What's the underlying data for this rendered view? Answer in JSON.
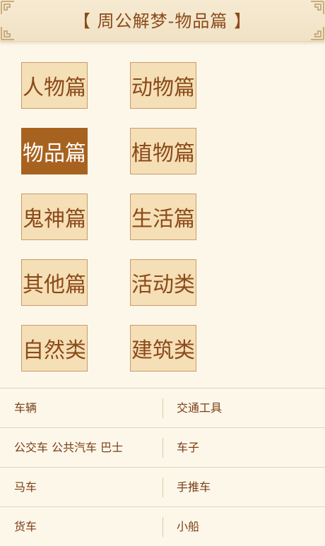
{
  "header": {
    "title": "【 周公解梦-物品篇 】"
  },
  "categories": [
    {
      "label": "人物篇",
      "active": false
    },
    {
      "label": "动物篇",
      "active": false
    },
    {
      "label": "物品篇",
      "active": true
    },
    {
      "label": "植物篇",
      "active": false
    },
    {
      "label": "鬼神篇",
      "active": false
    },
    {
      "label": "生活篇",
      "active": false
    },
    {
      "label": "其他篇",
      "active": false
    },
    {
      "label": "活动类",
      "active": false
    },
    {
      "label": "自然类",
      "active": false
    },
    {
      "label": "建筑类",
      "active": false
    }
  ],
  "items": [
    {
      "left": "车辆",
      "right": "交通工具"
    },
    {
      "left": "公交车 公共汽车 巴士",
      "right": "车子"
    },
    {
      "left": "马车",
      "right": "手推车"
    },
    {
      "left": "货车",
      "right": "小船"
    }
  ],
  "colors": {
    "accent": "#a8621f",
    "text": "#8b4a1a",
    "tile": "#f5dfb6"
  },
  "icons": {
    "corner": "corner-ornament-icon"
  }
}
